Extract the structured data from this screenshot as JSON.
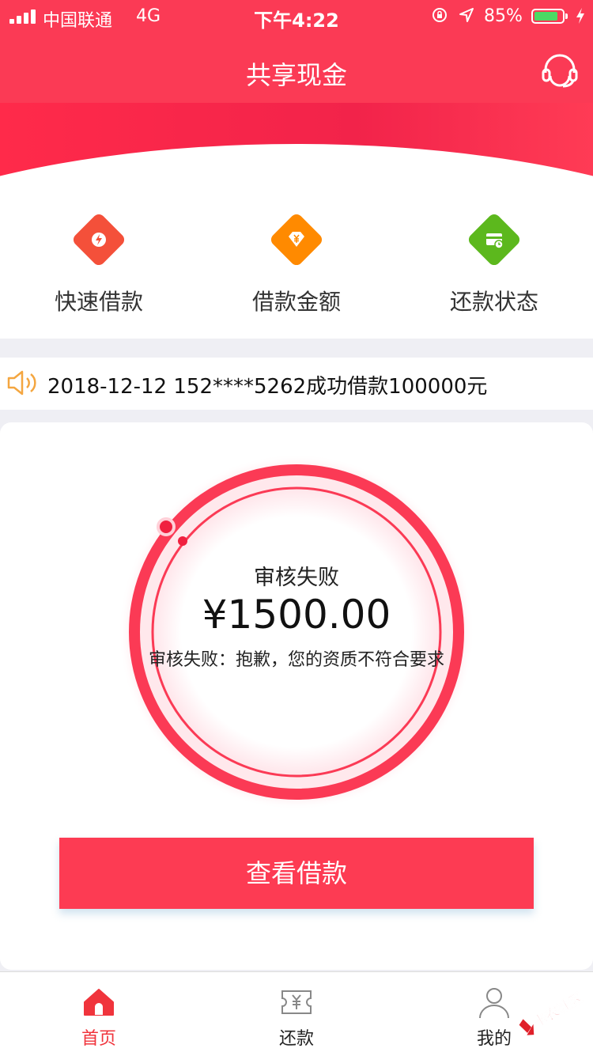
{
  "status_bar": {
    "carrier": "中国联通",
    "network": "4G",
    "time": "下午4:22",
    "battery_percent_label": "85%",
    "battery_level": 0.85,
    "battery_color": "#4cd964"
  },
  "header": {
    "title": "共享现金",
    "support_icon": "headset-icon",
    "background_color": "#fb3a55"
  },
  "quick_menu": [
    {
      "label": "快速借款",
      "icon": "lightning-icon",
      "color": "#f4503a"
    },
    {
      "label": "借款金额",
      "icon": "yen-diamond-icon",
      "color": "#ff8a00"
    },
    {
      "label": "还款状态",
      "icon": "card-icon",
      "color": "#5cb81d"
    }
  ],
  "notice": {
    "icon": "speaker-icon",
    "text": "2018-12-12 152****5262成功借款100000元"
  },
  "loan_status": {
    "title": "审核失败",
    "amount": "¥1500.00",
    "description": "审核失败：抱歉，您的资质不符合要求",
    "accent_color": "#fd3b53"
  },
  "primary_button": {
    "label": "查看借款"
  },
  "tab_bar": [
    {
      "label": "首页",
      "icon": "home-icon",
      "active": true
    },
    {
      "label": "还款",
      "icon": "repay-ticket-icon",
      "active": false
    },
    {
      "label": "我的",
      "icon": "user-icon",
      "active": false
    }
  ],
  "watermark": {
    "text": "卡农社区",
    "icon": "kanong-logo-icon"
  }
}
